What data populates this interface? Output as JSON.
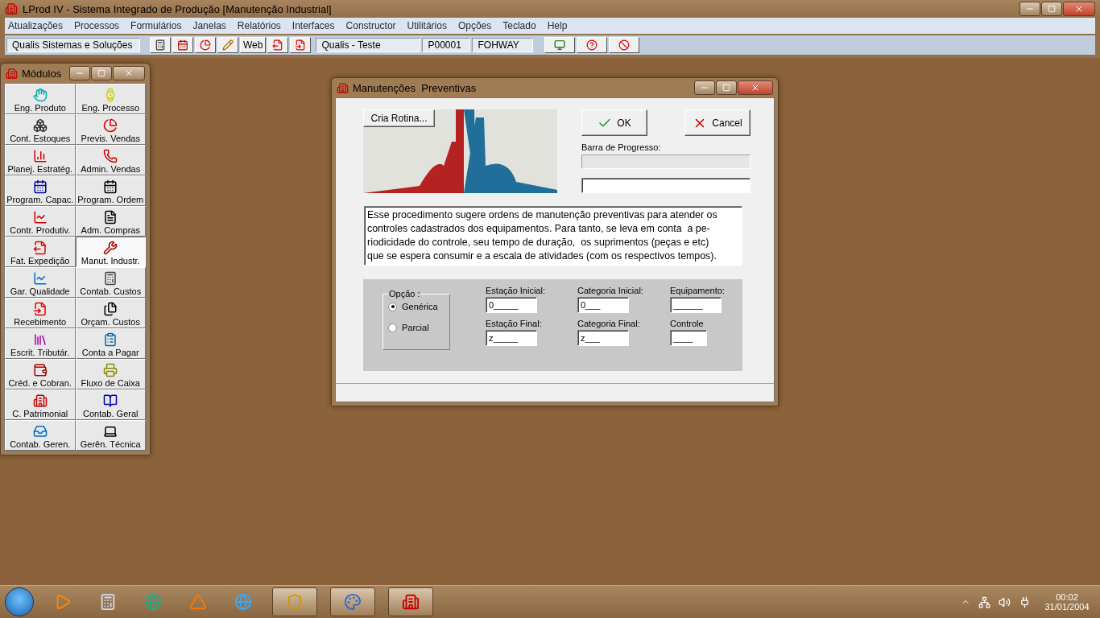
{
  "window": {
    "title": "LProd IV - Sistema Integrado de Produção [Manutenção Industrial]"
  },
  "menu": [
    "Atualizações",
    "Processos",
    "Formulários",
    "Janelas",
    "Relatórios",
    "Interfaces",
    "Constructor",
    "Utilitários",
    "Opções",
    "Teclado",
    "Help"
  ],
  "toolbar": {
    "company": "Qualis Sistemas e Soluções",
    "web_label": "Web",
    "fields": [
      "Qualis - Teste",
      "P00001",
      "FOHWAY"
    ]
  },
  "modules": {
    "title": "Módulos",
    "items": [
      {
        "label": "Eng. Produto",
        "selected": false
      },
      {
        "label": "Eng. Processo",
        "selected": false
      },
      {
        "label": "Cont. Estoques",
        "selected": false
      },
      {
        "label": "Previs.  Vendas",
        "selected": false
      },
      {
        "label": "Planej. Estratég.",
        "selected": false
      },
      {
        "label": "Admin. Vendas",
        "selected": false
      },
      {
        "label": "Program. Capac.",
        "selected": false
      },
      {
        "label": "Program. Ordem",
        "selected": false
      },
      {
        "label": "Contr. Produtiv.",
        "selected": false
      },
      {
        "label": "Adm. Compras",
        "selected": false
      },
      {
        "label": "Fat. Expedição",
        "selected": false
      },
      {
        "label": "Manut. Industr.",
        "selected": true
      },
      {
        "label": "Gar. Qualidade",
        "selected": false
      },
      {
        "label": "Contab. Custos",
        "selected": false
      },
      {
        "label": "Recebimento",
        "selected": false
      },
      {
        "label": "Orçam. Custos",
        "selected": false
      },
      {
        "label": "Escrit. Tributár.",
        "selected": false
      },
      {
        "label": "Conta a Pagar",
        "selected": false
      },
      {
        "label": "Créd. e Cobran.",
        "selected": false
      },
      {
        "label": "Fluxo de Caixa",
        "selected": false
      },
      {
        "label": "C. Patrimonial",
        "selected": false
      },
      {
        "label": "Contab. Geral",
        "selected": false
      },
      {
        "label": "Contab. Geren.",
        "selected": false
      },
      {
        "label": "Gerên. Técnica",
        "selected": false
      }
    ]
  },
  "dialog": {
    "title": "Manutenções  Preventivas",
    "cria_rotina": "Cria Rotina...",
    "ok": "OK",
    "cancel": "Cancel",
    "progress_label": "Barra de Progresso:",
    "progress": {
      "level": 0
    },
    "description": "Esse procedimento sugere ordens de manutenção preventivas para atender os\ncontroles cadastrados dos equipamentos. Para tanto, se leva em conta  a pe-\nriodicidade do controle, seu tempo de duração,  os suprimentos (peças e etc)\nque se espera consumir e a escala de atividades (com os respectivos tempos).",
    "option_group": {
      "label": "Opção :",
      "options": [
        {
          "label": "Genérica",
          "selected": true
        },
        {
          "label": "Parcial",
          "selected": false
        }
      ]
    },
    "fields": [
      {
        "label": "Estação Inicial:",
        "value": "0_____"
      },
      {
        "label": "Categoria Inicial:",
        "value": "0___"
      },
      {
        "label": "Equipamento:",
        "value": "______"
      },
      {
        "label": "Estação Final:",
        "value": "z_____"
      },
      {
        "label": "Categoria Final:",
        "value": "z___"
      },
      {
        "label": "Controle",
        "value": "____"
      }
    ]
  },
  "taskbar": {
    "time": "00:02",
    "date": "31/01/2004"
  }
}
